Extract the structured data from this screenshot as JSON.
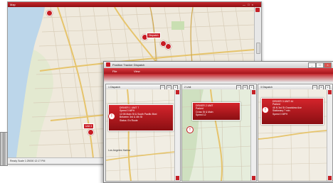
{
  "map_window": {
    "title": "Map",
    "controls": "— □ ×",
    "status": "Ready   Scale 1:25000   12:17 PM",
    "labels": {
      "popup_a": "Dispatch",
      "popup_b": "Unit 3"
    }
  },
  "dispatcher": {
    "title": "Position Tracker Dispatch",
    "menu": [
      "File",
      "View"
    ],
    "window_buttons": [
      "_",
      "□",
      "×"
    ],
    "panels": [
      {
        "title": "1 Dispatch",
        "icons": [
          "□",
          "≡",
          "×"
        ],
        "card": [
          "DRIVER 1 UNIT 7",
          "Speed 0 MPH",
          "12:06 Main St & South Pacific Blvd",
          "Between 3rd & 4th St",
          "Status: En Route"
        ],
        "map_label": "Los Angeles Harbor"
      },
      {
        "title": "2 Unit",
        "icons": [
          "□",
          "≡",
          "×"
        ],
        "card": [
          "DRIVER 2 UNIT",
          "Parked",
          "Cross St & Main",
          "Speed 12"
        ],
        "map_label": ""
      },
      {
        "title": "3 Dispatch",
        "icons": [
          "□",
          "≡",
          "×"
        ],
        "card": [
          "DRIVER 3 UNIT 44",
          "Parked",
          "45 N 3rd St Grandview Ave",
          "Stationary 7 min",
          "Speed 0 MPH"
        ],
        "map_label": ""
      }
    ]
  }
}
